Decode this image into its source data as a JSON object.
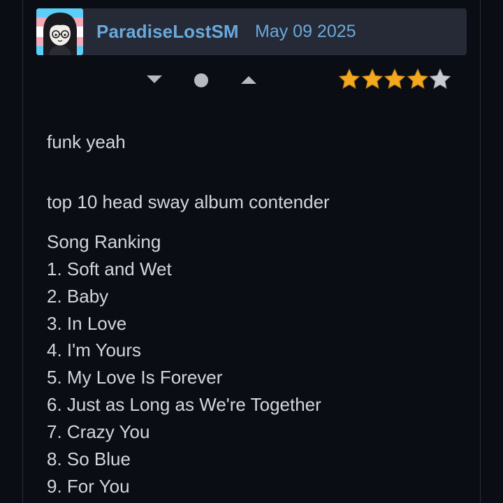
{
  "review": {
    "username": "ParadiseLostSM",
    "date": "May 09 2025",
    "rating": 4,
    "rating_max": 5,
    "star_fill_color": "#f2a91f",
    "star_empty_color": "#c9ccd3",
    "username_color": "#6aa9dc",
    "icons": {
      "vote_down": "triangle-down-icon",
      "vote_neutral": "circle-icon",
      "vote_up": "triangle-up-icon"
    },
    "body": {
      "line1": "funk yeah",
      "line2": "top 10 head sway album contender",
      "ranking_heading": "Song Ranking",
      "ranking": [
        "1. Soft and Wet",
        "2. Baby",
        "3. In Love",
        "4. I'm Yours",
        "5. My Love Is Forever",
        "6. Just as Long as We're Together",
        "7. Crazy You",
        "8. So Blue",
        "9. For You"
      ]
    }
  }
}
